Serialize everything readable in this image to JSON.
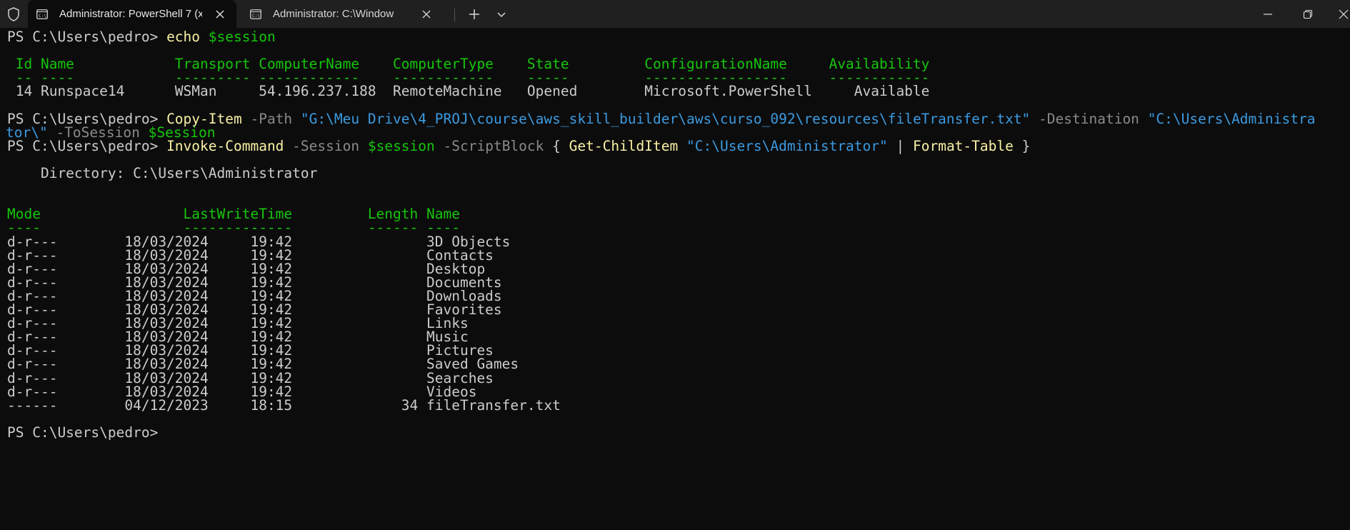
{
  "window": {
    "tabs": [
      {
        "title": "Administrator: PowerShell 7 (x",
        "active": true,
        "icon": "terminal-icon"
      },
      {
        "title": "Administrator: C:\\Windows\\sys",
        "active": false,
        "icon": "terminal-icon"
      }
    ],
    "icons": {
      "shield": "shield-icon",
      "new_tab": "plus-icon",
      "dropdown": "chevron-down-icon",
      "minimize": "minimize-icon",
      "maximize": "restore-icon",
      "close": "close-icon"
    },
    "colors": {
      "titlebar_bg": "#202020",
      "terminal_bg": "#0c0c0c",
      "text": "#cccccc",
      "command": "#f9f1a5",
      "variable": "#16c60c",
      "string": "#3b9ae0",
      "parameter": "#8a8a8a",
      "table_header": "#16c60c"
    }
  },
  "terminal": {
    "lines": [
      {
        "segments": [
          {
            "t": "PS C:\\Users\\pedro> ",
            "c": "def"
          },
          {
            "t": "echo ",
            "c": "cmd"
          },
          {
            "t": "$session",
            "c": "var"
          }
        ]
      },
      {
        "segments": []
      },
      {
        "segments": [
          {
            "t": " Id Name            Transport ComputerName    ComputerType    State         ConfigurationName     Availability",
            "c": "hdr"
          }
        ]
      },
      {
        "segments": [
          {
            "t": " -- ----            --------- ------------    ------------    -----         -----------------     ------------",
            "c": "hdr"
          }
        ]
      },
      {
        "segments": [
          {
            "t": " 14 Runspace14      WSMan     54.196.237.188  RemoteMachine   Opened        Microsoft.PowerShell     Available",
            "c": "def"
          }
        ]
      },
      {
        "segments": []
      },
      {
        "segments": [
          {
            "t": "PS C:\\Users\\pedro> ",
            "c": "def"
          },
          {
            "t": "Copy-Item ",
            "c": "cmd"
          },
          {
            "t": "-Path ",
            "c": "par"
          },
          {
            "t": "\"G:\\Meu Drive\\4_PROJ\\course\\aws_skill_builder\\aws\\curso_092\\resources\\fileTransfer.txt\" ",
            "c": "str"
          },
          {
            "t": "-Destination ",
            "c": "par"
          },
          {
            "t": "\"C:\\Users\\Administra",
            "c": "str"
          }
        ]
      },
      {
        "segments": [
          {
            "t": "tor\\\" ",
            "c": "str"
          },
          {
            "t": "-ToSession ",
            "c": "par"
          },
          {
            "t": "$Session",
            "c": "var"
          }
        ]
      },
      {
        "segments": [
          {
            "t": "PS C:\\Users\\pedro> ",
            "c": "def"
          },
          {
            "t": "Invoke-Command ",
            "c": "cmd"
          },
          {
            "t": "-Session ",
            "c": "par"
          },
          {
            "t": "$session ",
            "c": "var"
          },
          {
            "t": "-ScriptBlock ",
            "c": "par"
          },
          {
            "t": "{ ",
            "c": "def"
          },
          {
            "t": "Get-ChildItem ",
            "c": "cmd"
          },
          {
            "t": "\"C:\\Users\\Administrator\" ",
            "c": "str"
          },
          {
            "t": "| ",
            "c": "def"
          },
          {
            "t": "Format-Table ",
            "c": "cmd"
          },
          {
            "t": "}",
            "c": "def"
          }
        ]
      },
      {
        "segments": []
      },
      {
        "segments": [
          {
            "t": "    Directory: C:\\Users\\Administrator",
            "c": "def"
          }
        ]
      },
      {
        "segments": []
      },
      {
        "segments": []
      },
      {
        "segments": [
          {
            "t": "Mode                 LastWriteTime         Length Name",
            "c": "hdr"
          }
        ]
      },
      {
        "segments": [
          {
            "t": "----                 -------------         ------ ----",
            "c": "hdr"
          }
        ]
      },
      {
        "segments": [
          {
            "t": "d-r---        18/03/2024     19:42                3D Objects",
            "c": "def"
          }
        ]
      },
      {
        "segments": [
          {
            "t": "d-r---        18/03/2024     19:42                Contacts",
            "c": "def"
          }
        ]
      },
      {
        "segments": [
          {
            "t": "d-r---        18/03/2024     19:42                Desktop",
            "c": "def"
          }
        ]
      },
      {
        "segments": [
          {
            "t": "d-r---        18/03/2024     19:42                Documents",
            "c": "def"
          }
        ]
      },
      {
        "segments": [
          {
            "t": "d-r---        18/03/2024     19:42                Downloads",
            "c": "def"
          }
        ]
      },
      {
        "segments": [
          {
            "t": "d-r---        18/03/2024     19:42                Favorites",
            "c": "def"
          }
        ]
      },
      {
        "segments": [
          {
            "t": "d-r---        18/03/2024     19:42                Links",
            "c": "def"
          }
        ]
      },
      {
        "segments": [
          {
            "t": "d-r---        18/03/2024     19:42                Music",
            "c": "def"
          }
        ]
      },
      {
        "segments": [
          {
            "t": "d-r---        18/03/2024     19:42                Pictures",
            "c": "def"
          }
        ]
      },
      {
        "segments": [
          {
            "t": "d-r---        18/03/2024     19:42                Saved Games",
            "c": "def"
          }
        ]
      },
      {
        "segments": [
          {
            "t": "d-r---        18/03/2024     19:42                Searches",
            "c": "def"
          }
        ]
      },
      {
        "segments": [
          {
            "t": "d-r---        18/03/2024     19:42                Videos",
            "c": "def"
          }
        ]
      },
      {
        "segments": [
          {
            "t": "------        04/12/2023     18:15             34 fileTransfer.txt",
            "c": "def"
          }
        ]
      },
      {
        "segments": []
      },
      {
        "segments": [
          {
            "t": "PS C:\\Users\\pedro> ",
            "c": "def"
          }
        ]
      }
    ]
  }
}
